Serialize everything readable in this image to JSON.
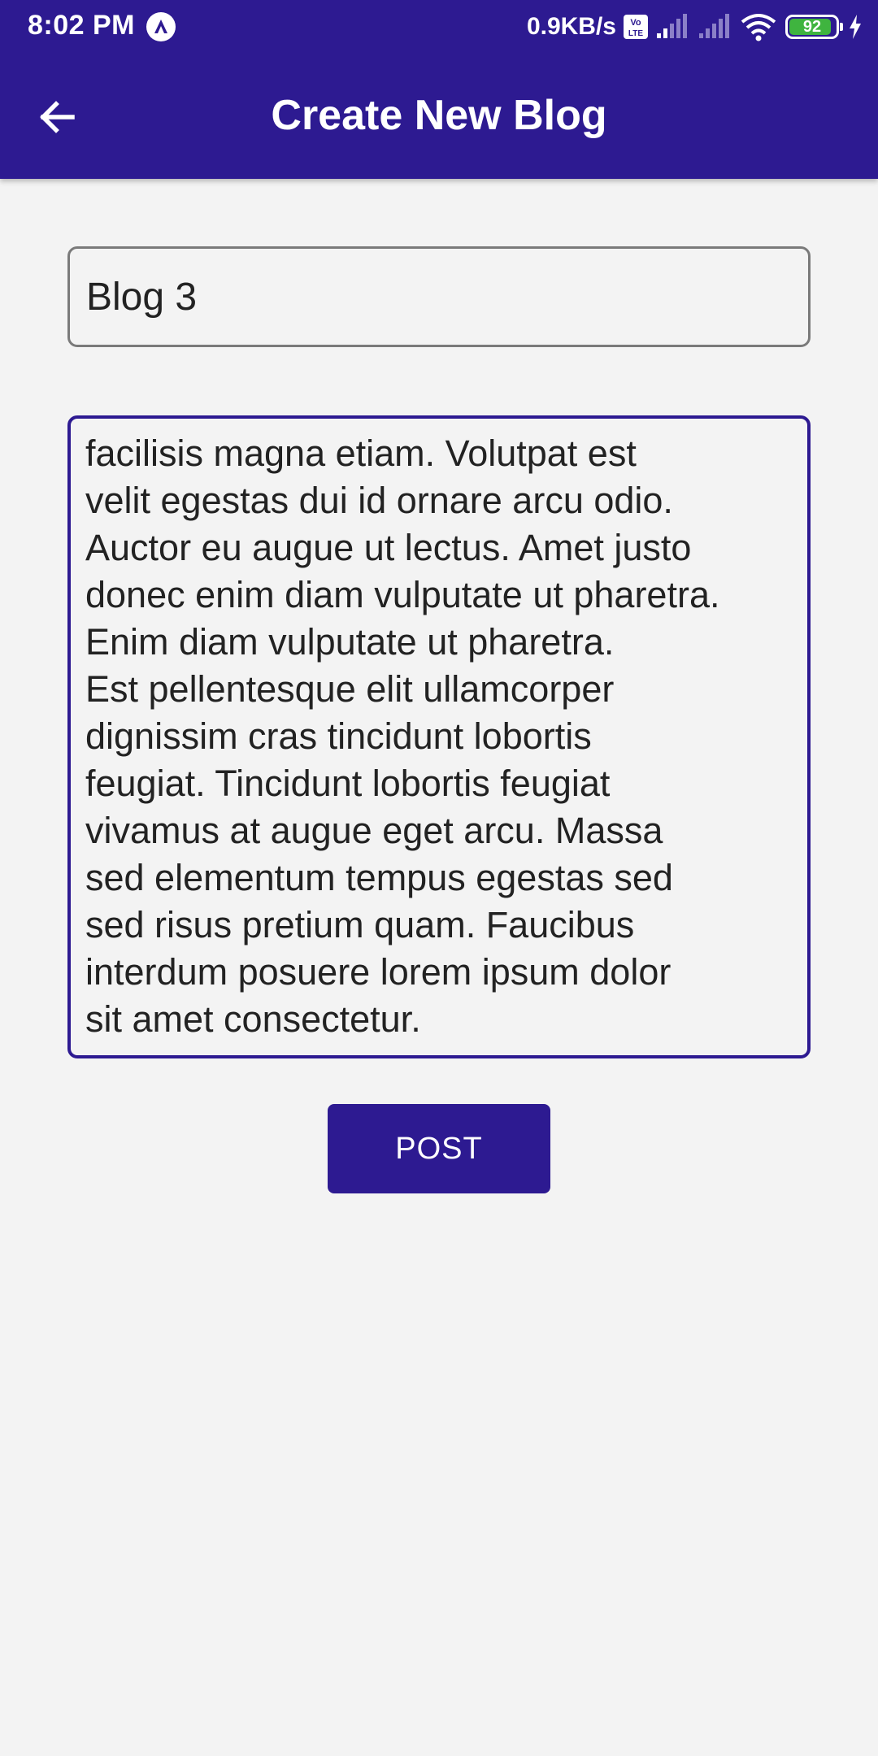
{
  "status_bar": {
    "time": "8:02 PM",
    "net_speed": "0.9KB/s",
    "volte_icon": "volte-lte-icon",
    "battery_level": "92",
    "battery_fraction": 0.92,
    "icons": [
      "nav-app-icon",
      "volte-icon",
      "signal-icon",
      "signal-icon",
      "wifi-icon",
      "battery-icon",
      "charging-icon"
    ]
  },
  "app_bar": {
    "title": "Create New Blog",
    "back_icon": "arrow-left-icon",
    "background_color": "#2d1a91"
  },
  "form": {
    "title_value": "Blog 3",
    "body_lines": [
      "facilisis magna etiam. Volutpat est",
      "velit egestas dui id ornare arcu odio.",
      "Auctor eu augue ut lectus. Amet justo",
      "donec enim diam vulputate ut pharetra.",
      "Enim diam vulputate ut pharetra.",
      "Est pellentesque elit ullamcorper",
      "dignissim cras tincidunt lobortis",
      "feugiat. Tincidunt lobortis feugiat",
      "vivamus at augue eget arcu. Massa",
      "sed elementum tempus egestas sed",
      "sed risus pretium quam. Faucibus",
      "interdum posuere lorem ipsum dolor",
      "sit amet consectetur."
    ],
    "post_label": "POST"
  },
  "colors": {
    "accent": "#2d1a91",
    "background": "#f3f3f3",
    "text": "#222222",
    "battery": "#3fb43f"
  }
}
